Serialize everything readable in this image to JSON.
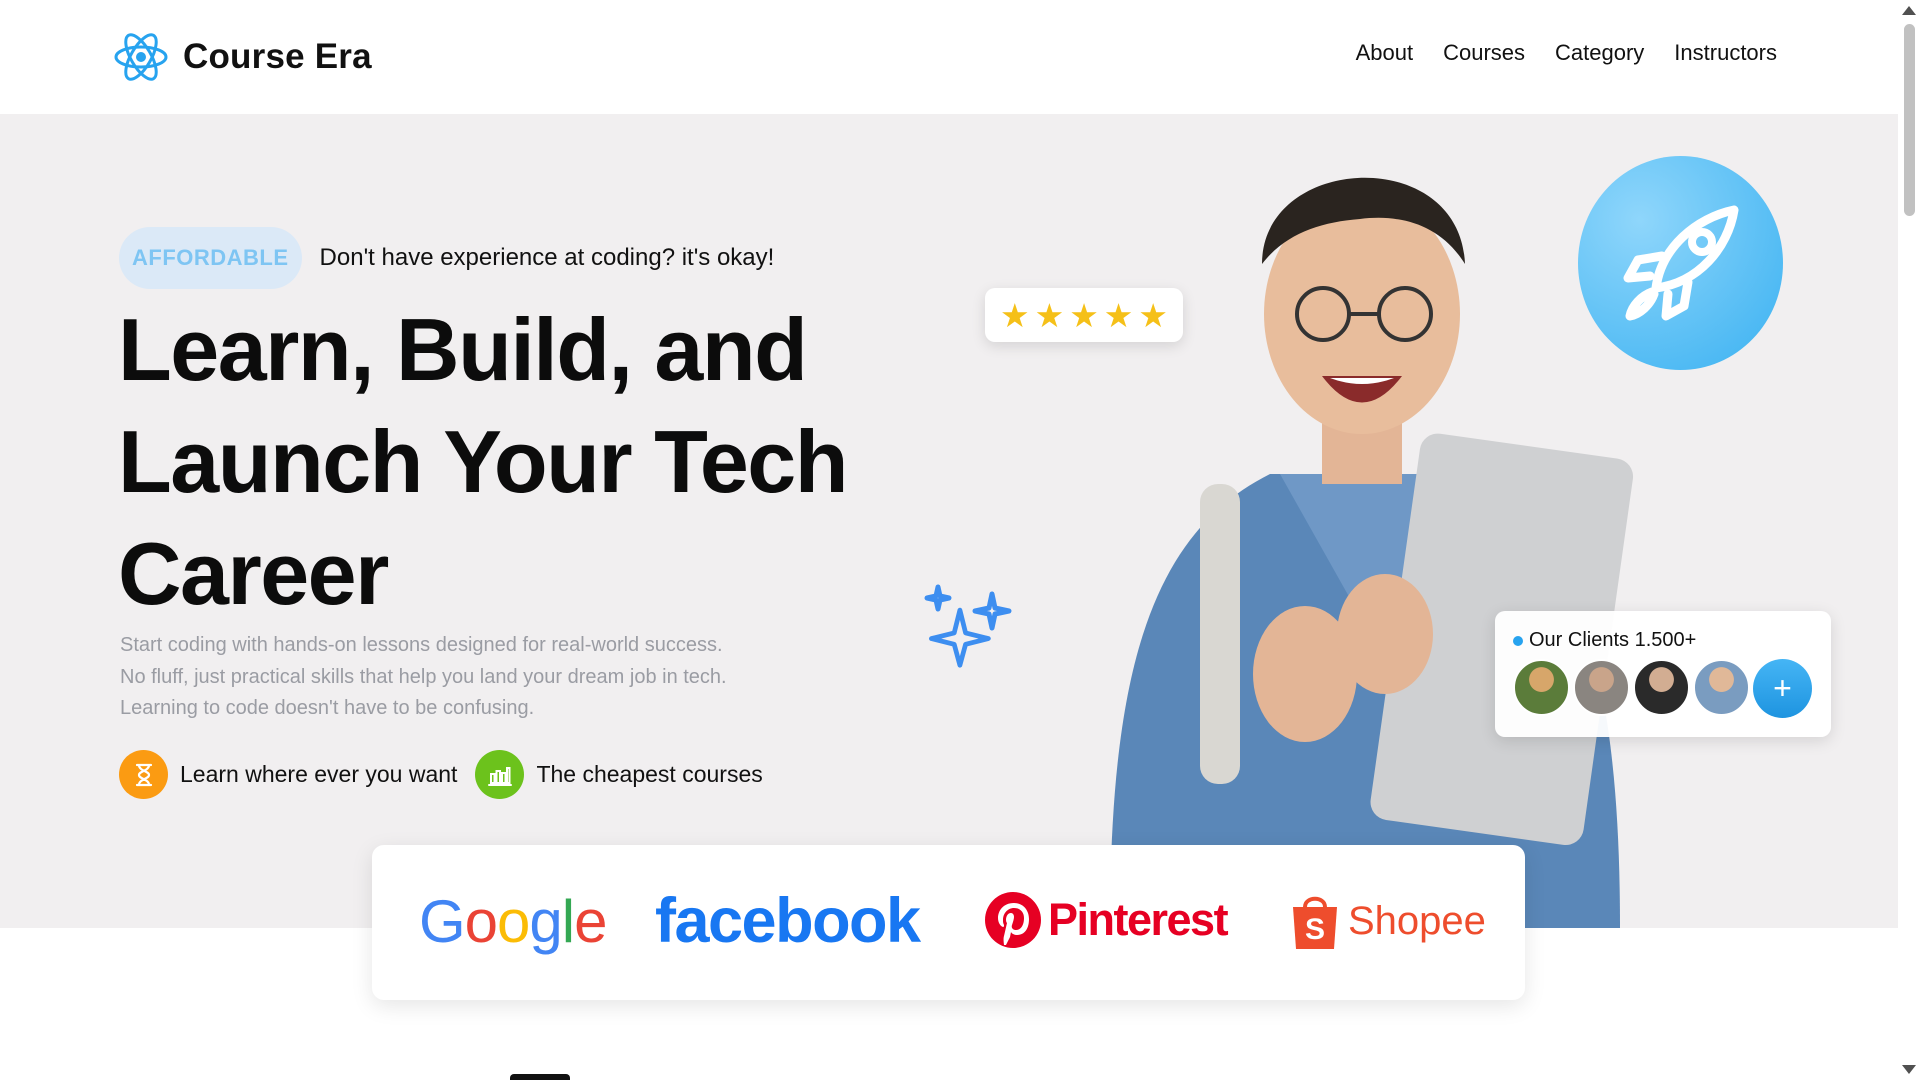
{
  "brand": {
    "name": "Course Era",
    "logo_icon": "atom-icon",
    "accent": "#27a3ef"
  },
  "nav": {
    "links": [
      "About",
      "Courses",
      "Category",
      "Instructors"
    ]
  },
  "hero": {
    "badge": "AFFORDABLE",
    "badge_text": "Don't have experience at coding? it's okay!",
    "title_lines": [
      "Learn, Build, and",
      "Launch Your Tech",
      "Career"
    ],
    "description_lines": [
      "Start coding with hands-on lessons designed for real-world success.",
      "No fluff, just practical skills that help you land your dream job in tech.",
      "Learning to code doesn't have to be confusing."
    ],
    "features": [
      {
        "label": "Learn where ever you want",
        "icon": "hourglass-icon",
        "color": "#fb9b12"
      },
      {
        "label": "The cheapest courses",
        "icon": "bar-chart-icon",
        "color": "#6cc21c"
      }
    ],
    "rating": {
      "stars": 5,
      "max": 5,
      "icon": "star-icon",
      "color": "#f5c018"
    },
    "rocket_icon": "rocket-icon",
    "sparkle_icon": "sparkles-icon",
    "clients": {
      "label": "Our Clients 1.500+",
      "add_icon": "plus-icon",
      "avatar_count": 4
    }
  },
  "brands": {
    "google": "Google",
    "facebook": "facebook",
    "pinterest": "Pinterest",
    "shopee": "Shopee"
  },
  "colors": {
    "hero_bg": "#f1eff0",
    "badge_bg": "#dbe9f7",
    "badge_text": "#7ec5f3",
    "description": "#9a9ca3"
  }
}
